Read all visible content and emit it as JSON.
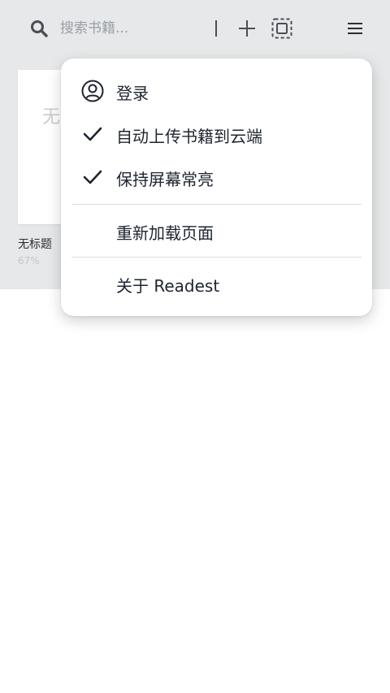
{
  "search": {
    "placeholder": "搜索书籍..."
  },
  "library": {
    "book": {
      "cover_text": "无",
      "title": "无标题",
      "progress": "67%"
    }
  },
  "menu": {
    "login": "登录",
    "auto_upload": "自动上传书籍到云端",
    "keep_screen_on": "保持屏幕常亮",
    "reload_page": "重新加载页面",
    "about": "关于 Readest",
    "auto_upload_checked": true,
    "keep_screen_on_checked": true
  },
  "icons": {
    "search": "search-icon",
    "add": "plus-icon",
    "select": "select-frame-icon",
    "menu": "hamburger-menu-icon",
    "account": "user-circle-icon",
    "check": "check-icon"
  },
  "colors": {
    "band": "#e6e8e9",
    "text": "#1e2430",
    "muted": "#9aa0a6"
  }
}
